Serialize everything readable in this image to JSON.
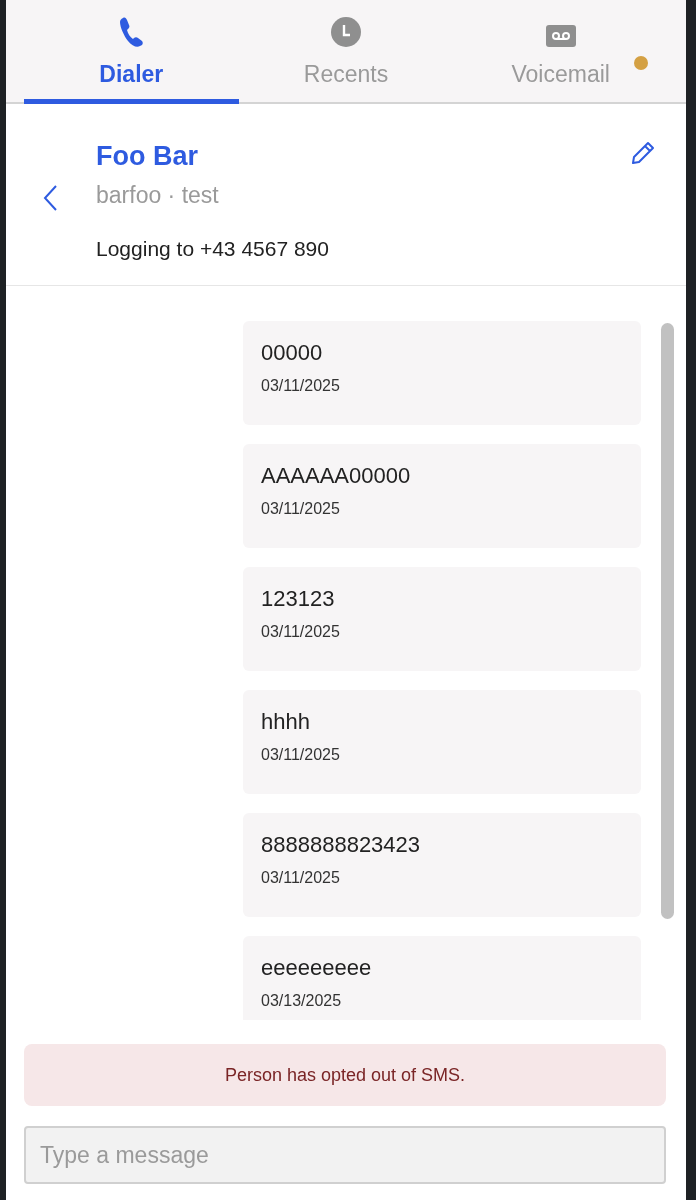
{
  "tabs": [
    {
      "label": "Dialer",
      "kind": "phone",
      "selected": true,
      "notification": false
    },
    {
      "label": "Recents",
      "kind": "clock",
      "selected": false,
      "notification": false
    },
    {
      "label": "Voicemail",
      "kind": "voicemail",
      "selected": false,
      "notification": true
    }
  ],
  "contact": {
    "name": "Foo Bar",
    "subtitle": "barfoo · test",
    "logging": "Logging to +43 4567 890"
  },
  "messages": [
    {
      "text": "00000",
      "date": "03/11/2025"
    },
    {
      "text": "AAAAAA00000",
      "date": "03/11/2025"
    },
    {
      "text": "123123",
      "date": "03/11/2025"
    },
    {
      "text": "hhhh",
      "date": "03/11/2025"
    },
    {
      "text": "8888888823423",
      "date": "03/11/2025"
    },
    {
      "text": "eeeeeeeee",
      "date": "03/13/2025"
    }
  ],
  "alert": "Person has opted out of SMS.",
  "composer": {
    "placeholder": "Type a message"
  }
}
